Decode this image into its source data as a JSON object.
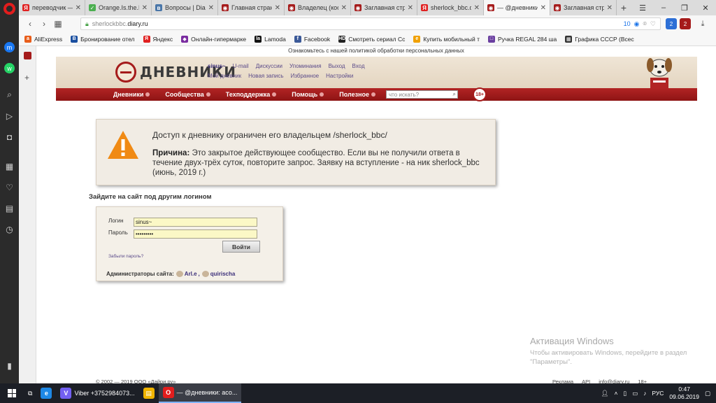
{
  "browser": {
    "tabs": [
      {
        "label": "переводчик —",
        "fav": "Я",
        "color": "#e02020",
        "active": false
      },
      {
        "label": "Orange.Is.the.Ne",
        "fav": "✓",
        "color": "#4caf50",
        "active": false
      },
      {
        "label": "Вопросы | Diar",
        "fav": "в",
        "color": "#4a76a8",
        "active": false
      },
      {
        "label": "Главная страни",
        "fav": "◉",
        "color": "#a51b1b",
        "active": false
      },
      {
        "label": "Владелец (коор",
        "fav": "◉",
        "color": "#a51b1b",
        "active": false
      },
      {
        "label": "Заглавная стра",
        "fav": "◉",
        "color": "#a51b1b",
        "active": false
      },
      {
        "label": "sherlock_bbc.di",
        "fav": "Я",
        "color": "#e02020",
        "active": false
      },
      {
        "label": "— @дневники:",
        "fav": "◉",
        "color": "#a51b1b",
        "active": true
      },
      {
        "label": "Заглавная стран",
        "fav": "◉",
        "color": "#a51b1b",
        "active": false
      }
    ],
    "url_prefix": "sherlockbbc.",
    "url_domain": "diary.ru",
    "url_badge": "10",
    "bookmarks": [
      {
        "label": "AliExpress",
        "fav": "a",
        "color": "#e85d1a"
      },
      {
        "label": "Бронирование отел",
        "fav": "B",
        "color": "#1a4fa0"
      },
      {
        "label": "Яндекс",
        "fav": "Я",
        "color": "#e02020"
      },
      {
        "label": "Онлайн-гипермарке",
        "fav": "◆",
        "color": "#7a2ca0"
      },
      {
        "label": "Lamoda",
        "fav": "la",
        "color": "#111"
      },
      {
        "label": "Facebook",
        "fav": "f",
        "color": "#3b5998"
      },
      {
        "label": "Смотреть сериал Сс",
        "fav": "HD",
        "color": "#222"
      },
      {
        "label": "Купить мобильный т",
        "fav": "e",
        "color": "#f0a000"
      },
      {
        "label": "Ручка REGAL 284 ша",
        "fav": "□",
        "color": "#6a3fa0"
      },
      {
        "label": "Графика СССР (Всес",
        "fav": "▦",
        "color": "#333"
      }
    ]
  },
  "site": {
    "policy_notice": "Ознакомьтесь с нашей политикой обработки персональных данных",
    "logo_text": "ДНЕВНИКИ",
    "user_nav_top": [
      "sinus~",
      "U-mail",
      "Дискуссии",
      "Упоминания",
      "Выход",
      "Вход"
    ],
    "user_nav_bottom": [
      "Мой дневник",
      "Новая запись",
      "Избранное",
      "Настройки"
    ],
    "menu": [
      "Дневники",
      "Сообщества",
      "Техподдержка",
      "Помощь",
      "Полезное"
    ],
    "search_placeholder": "что искать?",
    "age_badge": "18+"
  },
  "warning": {
    "title": "Доступ к дневнику ограничен его владельцем /sherlock_bbc/",
    "reason_label": "Причина:",
    "reason_text": " Это закрытое действующее сообщество. Если вы не получили ответа в течение двух-трёх суток, повторите запрос. Заявку на вступление - на ник sherlock_bbc (июнь, 2019 г.)"
  },
  "login": {
    "heading": "Зайдите на сайт под другим логином",
    "login_label": "Логин",
    "login_value": "sinus~",
    "password_label": "Пароль",
    "password_value": "•••••••••",
    "submit_label": "Войти",
    "forgot_label": "Забыли пароль?",
    "admins_label": "Администраторы сайта:",
    "admin1": "Arl.e",
    "admin2": "quirischa"
  },
  "watermark": {
    "title": "Активация Windows",
    "text": "Чтобы активировать Windows, перейдите в раздел \"Параметры\"."
  },
  "footer": {
    "copyright": "© 2002 — 2019 ООО «Дайри.ру»",
    "links": [
      "Реклама",
      "API",
      "info@diary.ru",
      "18+"
    ]
  },
  "taskbar": {
    "items": [
      {
        "label": "",
        "ico": "e",
        "color": "#1e88e5",
        "active": false
      },
      {
        "label": "Viber +3752984073...",
        "ico": "V",
        "color": "#7360f2",
        "active": false
      },
      {
        "label": "",
        "ico": "▤",
        "color": "#f0b400",
        "active": false
      },
      {
        "label": "— @дневники: асо...",
        "ico": "O",
        "color": "#e21d1d",
        "active": true
      }
    ],
    "lang": "РУС",
    "time": "0:47",
    "date": "09.06.2019"
  }
}
